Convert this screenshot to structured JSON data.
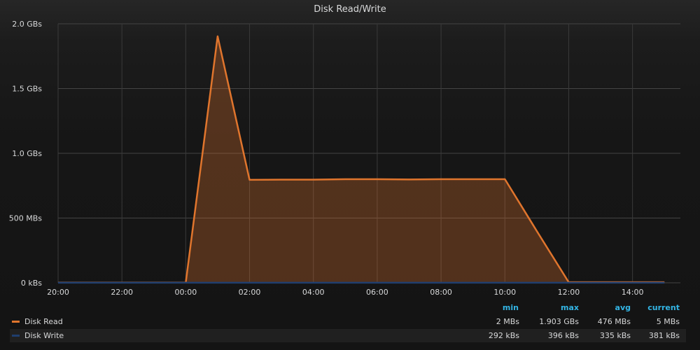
{
  "panel": {
    "title": "Disk Read/Write"
  },
  "legend": {
    "headers": {
      "min": "min",
      "max": "max",
      "avg": "avg",
      "current": "current"
    },
    "rows": [
      {
        "name": "Disk Read",
        "color": "#e0752d",
        "min": "2 MBs",
        "max": "1.903 GBs",
        "avg": "476 MBs",
        "current": "5 MBs"
      },
      {
        "name": "Disk Write",
        "color": "#1f3e6e",
        "min": "292 kBs",
        "max": "396 kBs",
        "avg": "335 kBs",
        "current": "381 kBs"
      }
    ]
  },
  "chart_data": {
    "type": "area",
    "title": "Disk Read/Write",
    "x_ticks": [
      "20:00",
      "22:00",
      "00:00",
      "02:00",
      "04:00",
      "06:00",
      "08:00",
      "10:00",
      "12:00",
      "14:00"
    ],
    "y_ticks": [
      "0 kBs",
      "500 MBs",
      "1.0 GBs",
      "1.5 GBs",
      "2.0 GBs"
    ],
    "ylim": [
      0,
      2000
    ],
    "y_unit": "MBs",
    "grid": true,
    "legend_position": "bottom",
    "series": [
      {
        "name": "Disk Read",
        "color": "#e0752d",
        "fill": true,
        "x": [
          "20:00",
          "21:00",
          "22:00",
          "23:00",
          "00:00",
          "01:00",
          "02:00",
          "03:00",
          "04:00",
          "05:00",
          "06:00",
          "07:00",
          "08:00",
          "09:00",
          "10:00",
          "11:00",
          "12:00",
          "13:00",
          "14:00",
          "15:00"
        ],
        "values": [
          2,
          2,
          2,
          2,
          2,
          1903,
          795,
          797,
          797,
          800,
          800,
          798,
          800,
          800,
          800,
          400,
          5,
          5,
          5,
          5
        ]
      },
      {
        "name": "Disk Write",
        "color": "#1f3e6e",
        "fill": true,
        "x": [
          "20:00",
          "21:00",
          "22:00",
          "23:00",
          "00:00",
          "01:00",
          "02:00",
          "03:00",
          "04:00",
          "05:00",
          "06:00",
          "07:00",
          "08:00",
          "09:00",
          "10:00",
          "11:00",
          "12:00",
          "13:00",
          "14:00",
          "15:00"
        ],
        "values": [
          0.3,
          0.3,
          0.3,
          0.3,
          0.3,
          0.4,
          0.3,
          0.3,
          0.3,
          0.3,
          0.3,
          0.3,
          0.3,
          0.3,
          0.3,
          0.3,
          0.3,
          0.3,
          0.4,
          0.4
        ]
      }
    ]
  }
}
